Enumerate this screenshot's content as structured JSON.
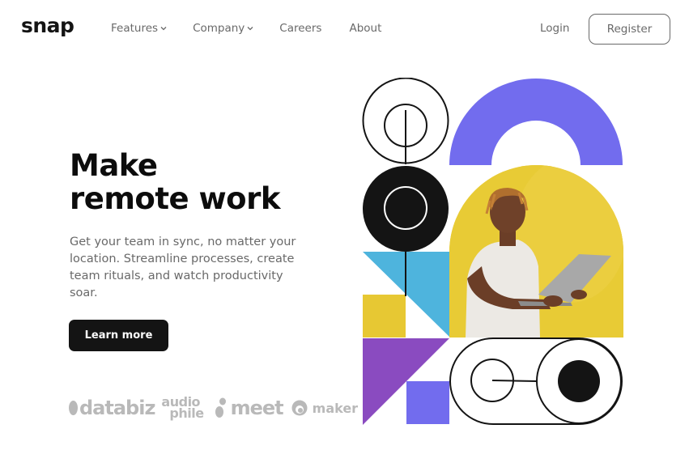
{
  "brand": {
    "name": "snap"
  },
  "nav": {
    "items": [
      {
        "label": "Features",
        "has_dropdown": true
      },
      {
        "label": "Company",
        "has_dropdown": true
      },
      {
        "label": "Careers",
        "has_dropdown": false
      },
      {
        "label": "About",
        "has_dropdown": false
      }
    ]
  },
  "auth": {
    "login_label": "Login",
    "register_label": "Register"
  },
  "hero": {
    "title_line1": "Make",
    "title_line2": "remote work",
    "description": "Get your team in sync, no matter your location. Streamline processes, create team rituals, and watch productivity soar.",
    "cta_label": "Learn more"
  },
  "clients": {
    "databiz": "databiz",
    "audiophile_top": "audio",
    "audiophile_bottom": "phile",
    "meet": "meet",
    "maker": "maker"
  },
  "colors": {
    "purple": "#726cee",
    "yellow": "#e7c833",
    "blue": "#4eb4dd",
    "violet": "#8a4bc0",
    "dark": "#141414",
    "gray_text": "#696969",
    "logo_gray": "#b9b9b9"
  },
  "icons": [
    "chevron-down-icon",
    "databiz-logo",
    "audiophile-logo",
    "meet-logo",
    "maker-logo"
  ]
}
